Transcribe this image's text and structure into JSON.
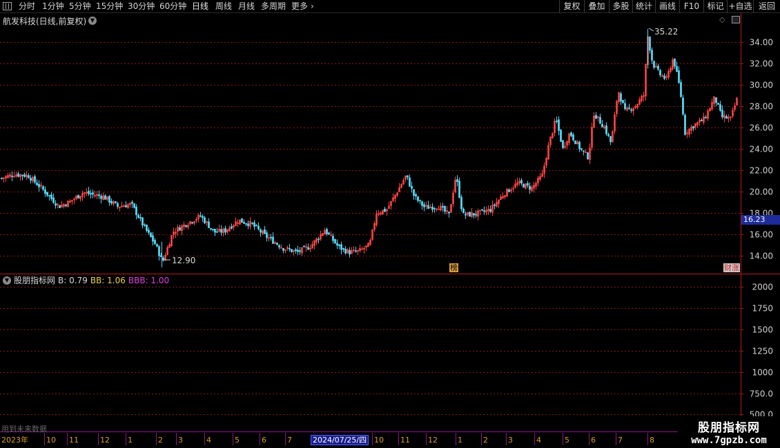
{
  "toolbar": {
    "periods": [
      "分时",
      "1分钟",
      "5分钟",
      "15分钟",
      "30分钟",
      "60分钟",
      "日线",
      "周线",
      "月线",
      "多周期",
      "更多"
    ],
    "active_period": "日线",
    "tools": [
      "复权",
      "叠加",
      "多股",
      "统计",
      "画线",
      "F10",
      "标记",
      "+自选",
      "返回"
    ]
  },
  "chart_title": "航发科技(日线,前复权)",
  "current_price": "16.23",
  "markers": {
    "high_label": "35.22",
    "low_label": "12.90",
    "bang": "榜",
    "caizhang": "财涨"
  },
  "indicator": {
    "name": "股朋指标网",
    "items": [
      {
        "text": "B: 0.79",
        "color": "#d8d8d8"
      },
      {
        "text": "BB: 1.06",
        "color": "#e6d24a"
      },
      {
        "text": "BBB: 1.00",
        "color": "#e040e0"
      }
    ]
  },
  "future_note": "用到未来数据",
  "date_highlight": "2024/07/25/四",
  "watermark": {
    "brand": "股朋指标网",
    "url": "www.7gpzb.com"
  },
  "colors": {
    "up": "#ff4444",
    "down": "#54d6f2",
    "grid": "#8a1a1a",
    "axis": "#b81c1c",
    "tag_bg": "#1e2b9a"
  },
  "chart_data": [
    {
      "type": "candlestick",
      "title": "航发科技(日线,前复权)",
      "ylim": [
        12.5,
        35.6
      ],
      "yticks": [
        "14.00",
        "16.00",
        "18.00",
        "20.00",
        "22.00",
        "24.00",
        "26.00",
        "28.00",
        "30.00",
        "32.00",
        "34.00"
      ],
      "high": 35.22,
      "low": 12.9,
      "last": 16.23,
      "x_labels": [
        "2023年",
        "10",
        "11",
        "12",
        "1",
        "2",
        "3",
        "4",
        "5",
        "6",
        "7",
        "2024/07/25/四",
        "10",
        "11",
        "12",
        "1",
        "2",
        "3",
        "4",
        "5",
        "6",
        "7",
        "8"
      ],
      "approx_close_path": [
        {
          "x": 0,
          "y": 21.2
        },
        {
          "x": 20,
          "y": 21.6
        },
        {
          "x": 40,
          "y": 21.5
        },
        {
          "x": 60,
          "y": 20.3
        },
        {
          "x": 85,
          "y": 18.6
        },
        {
          "x": 100,
          "y": 19.0
        },
        {
          "x": 120,
          "y": 19.9
        },
        {
          "x": 150,
          "y": 19.5
        },
        {
          "x": 170,
          "y": 18.6
        },
        {
          "x": 190,
          "y": 18.8
        },
        {
          "x": 210,
          "y": 16.5
        },
        {
          "x": 225,
          "y": 15.0
        },
        {
          "x": 235,
          "y": 13.4
        },
        {
          "x": 250,
          "y": 16.2
        },
        {
          "x": 270,
          "y": 17.0
        },
        {
          "x": 290,
          "y": 17.7
        },
        {
          "x": 310,
          "y": 16.2
        },
        {
          "x": 325,
          "y": 16.3
        },
        {
          "x": 345,
          "y": 17.3
        },
        {
          "x": 365,
          "y": 16.9
        },
        {
          "x": 385,
          "y": 15.8
        },
        {
          "x": 410,
          "y": 14.7
        },
        {
          "x": 430,
          "y": 14.3
        },
        {
          "x": 450,
          "y": 14.9
        },
        {
          "x": 470,
          "y": 16.4
        },
        {
          "x": 490,
          "y": 14.8
        },
        {
          "x": 505,
          "y": 14.3
        },
        {
          "x": 520,
          "y": 14.4
        },
        {
          "x": 535,
          "y": 15.0
        },
        {
          "x": 545,
          "y": 18.0
        },
        {
          "x": 560,
          "y": 18.3
        },
        {
          "x": 575,
          "y": 20.0
        },
        {
          "x": 588,
          "y": 21.5
        },
        {
          "x": 600,
          "y": 19.5
        },
        {
          "x": 615,
          "y": 18.5
        },
        {
          "x": 635,
          "y": 18.6
        },
        {
          "x": 650,
          "y": 17.8
        },
        {
          "x": 660,
          "y": 21.5
        },
        {
          "x": 670,
          "y": 17.8
        },
        {
          "x": 690,
          "y": 17.9
        },
        {
          "x": 710,
          "y": 18.3
        },
        {
          "x": 730,
          "y": 19.8
        },
        {
          "x": 750,
          "y": 20.8
        },
        {
          "x": 770,
          "y": 20.3
        },
        {
          "x": 785,
          "y": 21.5
        },
        {
          "x": 795,
          "y": 24.5
        },
        {
          "x": 805,
          "y": 26.8
        },
        {
          "x": 815,
          "y": 24.0
        },
        {
          "x": 825,
          "y": 25.5
        },
        {
          "x": 840,
          "y": 24.0
        },
        {
          "x": 852,
          "y": 23.2
        },
        {
          "x": 860,
          "y": 27.3
        },
        {
          "x": 875,
          "y": 26.0
        },
        {
          "x": 885,
          "y": 24.5
        },
        {
          "x": 895,
          "y": 29.5
        },
        {
          "x": 905,
          "y": 27.5
        },
        {
          "x": 920,
          "y": 28.0
        },
        {
          "x": 932,
          "y": 29.0
        },
        {
          "x": 938,
          "y": 34.5
        },
        {
          "x": 945,
          "y": 32.0
        },
        {
          "x": 955,
          "y": 31.0
        },
        {
          "x": 965,
          "y": 30.5
        },
        {
          "x": 975,
          "y": 32.5
        },
        {
          "x": 985,
          "y": 29.5
        },
        {
          "x": 992,
          "y": 25.5
        },
        {
          "x": 1005,
          "y": 26.2
        },
        {
          "x": 1020,
          "y": 26.8
        },
        {
          "x": 1035,
          "y": 28.8
        },
        {
          "x": 1045,
          "y": 27.0
        },
        {
          "x": 1058,
          "y": 26.8
        },
        {
          "x": 1068,
          "y": 28.8
        }
      ]
    },
    {
      "type": "line",
      "title": "股朋指标网",
      "ylim": [
        300,
        2150
      ],
      "yticks": [
        "2000",
        "1750",
        "1500",
        "1250",
        "1000",
        "750.0",
        "500.0"
      ],
      "series": []
    }
  ]
}
